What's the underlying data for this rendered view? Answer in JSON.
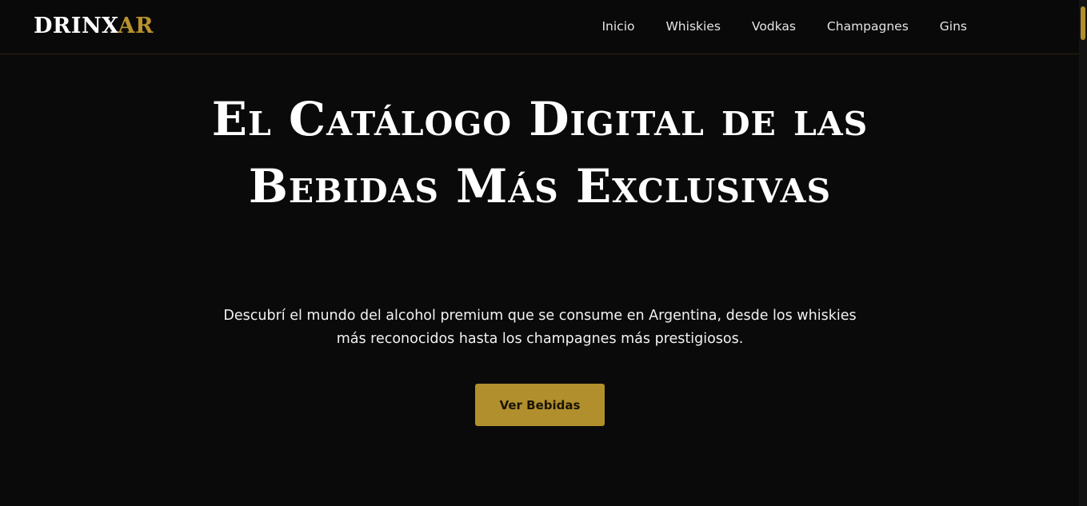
{
  "brand": {
    "logo_main": "DRINX",
    "logo_accent": "AR"
  },
  "nav": {
    "items": [
      {
        "label": "Inicio"
      },
      {
        "label": "Whiskies"
      },
      {
        "label": "Vodkas"
      },
      {
        "label": "Champagnes"
      },
      {
        "label": "Gins"
      }
    ]
  },
  "hero": {
    "title": "El Catálogo Digital de las Bebidas Más Exclusivas",
    "subtitle": "Descubrí el mundo del alcohol premium que se consume en Argentina, desde los whiskies más reconocidos hasta los champagnes más prestigiosos.",
    "cta_label": "Ver Bebidas"
  },
  "colors": {
    "background": "#0b0a0a",
    "accent": "#b18f2d",
    "text": "#ffffff"
  }
}
